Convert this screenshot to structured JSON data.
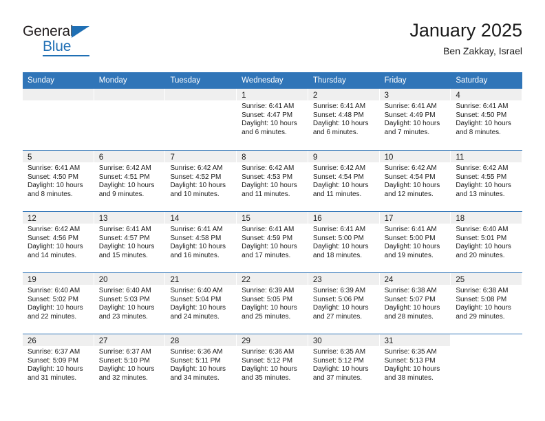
{
  "logo": {
    "word_top": "General",
    "word_bottom": "Blue",
    "triangle_icon": "triangle-icon"
  },
  "header": {
    "title": "January 2025",
    "subtitle": "Ben Zakkay, Israel"
  },
  "colors": {
    "header_blue": "#3075b8",
    "day_strip_gray": "#efefef",
    "text": "#1a1a1a",
    "logo_blue": "#1f6fb4"
  },
  "weekdays": [
    "Sunday",
    "Monday",
    "Tuesday",
    "Wednesday",
    "Thursday",
    "Friday",
    "Saturday"
  ],
  "weeks": [
    [
      {
        "day": "",
        "lines": []
      },
      {
        "day": "",
        "lines": []
      },
      {
        "day": "",
        "lines": []
      },
      {
        "day": "1",
        "lines": [
          "Sunrise: 6:41 AM",
          "Sunset: 4:47 PM",
          "Daylight: 10 hours",
          "and 6 minutes."
        ]
      },
      {
        "day": "2",
        "lines": [
          "Sunrise: 6:41 AM",
          "Sunset: 4:48 PM",
          "Daylight: 10 hours",
          "and 6 minutes."
        ]
      },
      {
        "day": "3",
        "lines": [
          "Sunrise: 6:41 AM",
          "Sunset: 4:49 PM",
          "Daylight: 10 hours",
          "and 7 minutes."
        ]
      },
      {
        "day": "4",
        "lines": [
          "Sunrise: 6:41 AM",
          "Sunset: 4:50 PM",
          "Daylight: 10 hours",
          "and 8 minutes."
        ]
      }
    ],
    [
      {
        "day": "5",
        "lines": [
          "Sunrise: 6:41 AM",
          "Sunset: 4:50 PM",
          "Daylight: 10 hours",
          "and 8 minutes."
        ]
      },
      {
        "day": "6",
        "lines": [
          "Sunrise: 6:42 AM",
          "Sunset: 4:51 PM",
          "Daylight: 10 hours",
          "and 9 minutes."
        ]
      },
      {
        "day": "7",
        "lines": [
          "Sunrise: 6:42 AM",
          "Sunset: 4:52 PM",
          "Daylight: 10 hours",
          "and 10 minutes."
        ]
      },
      {
        "day": "8",
        "lines": [
          "Sunrise: 6:42 AM",
          "Sunset: 4:53 PM",
          "Daylight: 10 hours",
          "and 11 minutes."
        ]
      },
      {
        "day": "9",
        "lines": [
          "Sunrise: 6:42 AM",
          "Sunset: 4:54 PM",
          "Daylight: 10 hours",
          "and 11 minutes."
        ]
      },
      {
        "day": "10",
        "lines": [
          "Sunrise: 6:42 AM",
          "Sunset: 4:54 PM",
          "Daylight: 10 hours",
          "and 12 minutes."
        ]
      },
      {
        "day": "11",
        "lines": [
          "Sunrise: 6:42 AM",
          "Sunset: 4:55 PM",
          "Daylight: 10 hours",
          "and 13 minutes."
        ]
      }
    ],
    [
      {
        "day": "12",
        "lines": [
          "Sunrise: 6:42 AM",
          "Sunset: 4:56 PM",
          "Daylight: 10 hours",
          "and 14 minutes."
        ]
      },
      {
        "day": "13",
        "lines": [
          "Sunrise: 6:41 AM",
          "Sunset: 4:57 PM",
          "Daylight: 10 hours",
          "and 15 minutes."
        ]
      },
      {
        "day": "14",
        "lines": [
          "Sunrise: 6:41 AM",
          "Sunset: 4:58 PM",
          "Daylight: 10 hours",
          "and 16 minutes."
        ]
      },
      {
        "day": "15",
        "lines": [
          "Sunrise: 6:41 AM",
          "Sunset: 4:59 PM",
          "Daylight: 10 hours",
          "and 17 minutes."
        ]
      },
      {
        "day": "16",
        "lines": [
          "Sunrise: 6:41 AM",
          "Sunset: 5:00 PM",
          "Daylight: 10 hours",
          "and 18 minutes."
        ]
      },
      {
        "day": "17",
        "lines": [
          "Sunrise: 6:41 AM",
          "Sunset: 5:00 PM",
          "Daylight: 10 hours",
          "and 19 minutes."
        ]
      },
      {
        "day": "18",
        "lines": [
          "Sunrise: 6:40 AM",
          "Sunset: 5:01 PM",
          "Daylight: 10 hours",
          "and 20 minutes."
        ]
      }
    ],
    [
      {
        "day": "19",
        "lines": [
          "Sunrise: 6:40 AM",
          "Sunset: 5:02 PM",
          "Daylight: 10 hours",
          "and 22 minutes."
        ]
      },
      {
        "day": "20",
        "lines": [
          "Sunrise: 6:40 AM",
          "Sunset: 5:03 PM",
          "Daylight: 10 hours",
          "and 23 minutes."
        ]
      },
      {
        "day": "21",
        "lines": [
          "Sunrise: 6:40 AM",
          "Sunset: 5:04 PM",
          "Daylight: 10 hours",
          "and 24 minutes."
        ]
      },
      {
        "day": "22",
        "lines": [
          "Sunrise: 6:39 AM",
          "Sunset: 5:05 PM",
          "Daylight: 10 hours",
          "and 25 minutes."
        ]
      },
      {
        "day": "23",
        "lines": [
          "Sunrise: 6:39 AM",
          "Sunset: 5:06 PM",
          "Daylight: 10 hours",
          "and 27 minutes."
        ]
      },
      {
        "day": "24",
        "lines": [
          "Sunrise: 6:38 AM",
          "Sunset: 5:07 PM",
          "Daylight: 10 hours",
          "and 28 minutes."
        ]
      },
      {
        "day": "25",
        "lines": [
          "Sunrise: 6:38 AM",
          "Sunset: 5:08 PM",
          "Daylight: 10 hours",
          "and 29 minutes."
        ]
      }
    ],
    [
      {
        "day": "26",
        "lines": [
          "Sunrise: 6:37 AM",
          "Sunset: 5:09 PM",
          "Daylight: 10 hours",
          "and 31 minutes."
        ]
      },
      {
        "day": "27",
        "lines": [
          "Sunrise: 6:37 AM",
          "Sunset: 5:10 PM",
          "Daylight: 10 hours",
          "and 32 minutes."
        ]
      },
      {
        "day": "28",
        "lines": [
          "Sunrise: 6:36 AM",
          "Sunset: 5:11 PM",
          "Daylight: 10 hours",
          "and 34 minutes."
        ]
      },
      {
        "day": "29",
        "lines": [
          "Sunrise: 6:36 AM",
          "Sunset: 5:12 PM",
          "Daylight: 10 hours",
          "and 35 minutes."
        ]
      },
      {
        "day": "30",
        "lines": [
          "Sunrise: 6:35 AM",
          "Sunset: 5:12 PM",
          "Daylight: 10 hours",
          "and 37 minutes."
        ]
      },
      {
        "day": "31",
        "lines": [
          "Sunrise: 6:35 AM",
          "Sunset: 5:13 PM",
          "Daylight: 10 hours",
          "and 38 minutes."
        ]
      },
      {
        "day": "",
        "lines": []
      }
    ]
  ]
}
